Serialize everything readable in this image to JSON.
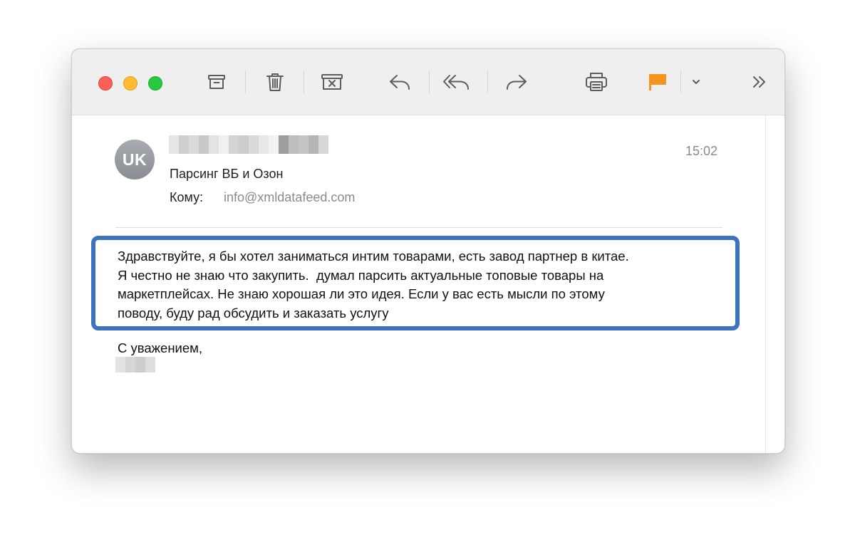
{
  "toolbar": {
    "buttons": [
      {
        "name": "archive-icon"
      },
      {
        "name": "trash-icon"
      },
      {
        "name": "junk-icon"
      },
      {
        "name": "reply-icon"
      },
      {
        "name": "reply-all-icon"
      },
      {
        "name": "forward-icon"
      },
      {
        "name": "print-icon"
      },
      {
        "name": "flag-icon",
        "color": "#f5951e"
      },
      {
        "name": "chevron-down-icon"
      },
      {
        "name": "more-icon"
      }
    ]
  },
  "message": {
    "avatar_initials": "UK",
    "sender_name": "",
    "subject": "Парсинг ВБ и Озон",
    "to_label": "Кому:",
    "to_value": "info@xmldatafeed.com",
    "time": "15:02",
    "body_lines": [
      "Здравствуйте, я бы хотел заниматься интим товарами, есть завод партнер в китае.",
      "Я честно не знаю что закупить.  думал парсить актуальные топовые товары на",
      "маркетплейсах. Не знаю хорошая ли это идея. Если у вас есть мысли по этому",
      "поводу, буду рад обсудить и заказать услугу"
    ],
    "sign_off": "С уважением,",
    "highlight_color": "#3b73bd"
  }
}
